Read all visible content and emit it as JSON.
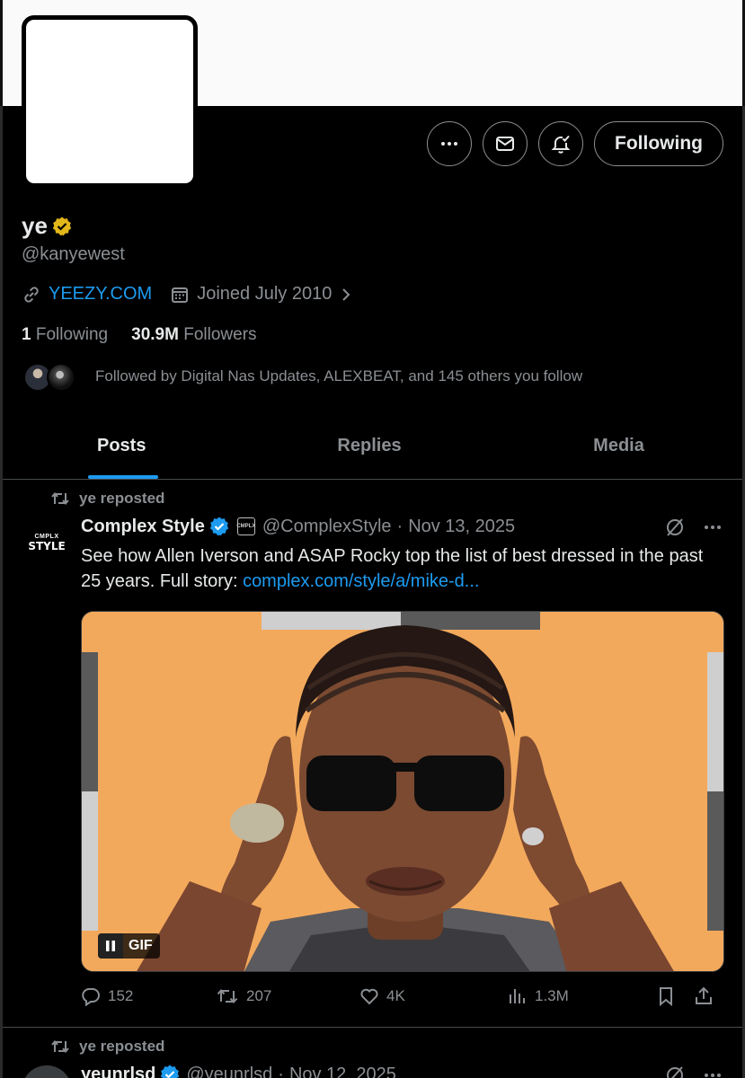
{
  "profile": {
    "display_name": "ye",
    "handle": "@kanyewest",
    "website": "YEEZY.COM",
    "joined": "Joined July 2010",
    "following_count": "1",
    "following_label": "Following",
    "followers_count": "30.9M",
    "followers_label": "Followers",
    "followed_by": "Followed by Digital Nas Updates, ALEXBEAT, and 145 others you follow",
    "follow_button": "Following",
    "verified_color": "#e2b719"
  },
  "tabs": [
    {
      "label": "Posts",
      "active": true
    },
    {
      "label": "Replies",
      "active": false
    },
    {
      "label": "Media",
      "active": false
    }
  ],
  "posts": [
    {
      "repost_label": "ye reposted",
      "avatar_top": "CMPLX",
      "avatar_text": "STYLE",
      "author": "Complex Style",
      "affiliate_badge": "CMPLX",
      "handle": "@ComplexStyle",
      "separator": "·",
      "date": "Nov 13, 2025",
      "text": "See how Allen Iverson and ASAP Rocky top the list of best dressed in the past 25 years. Full story: ",
      "link": "complex.com/style/a/mike-d...",
      "media_badge": "GIF",
      "replies": "152",
      "reposts": "207",
      "likes": "4K",
      "views": "1.3M"
    },
    {
      "repost_label": "ye reposted",
      "author": "yeunrlsd",
      "handle": "@yeunrlsd",
      "separator": "·",
      "date": "Nov 12, 2025"
    }
  ],
  "colors": {
    "accent": "#1d9bf0",
    "muted": "#8b8f93",
    "background": "#000000",
    "text": "#e7e9ea"
  }
}
